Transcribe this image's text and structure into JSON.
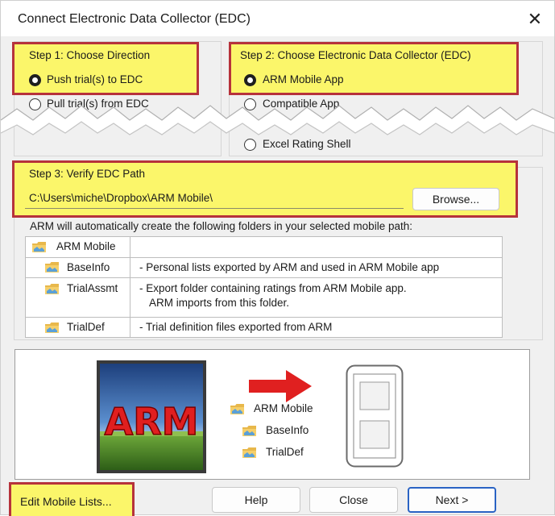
{
  "dialog": {
    "title": "Connect Electronic Data Collector (EDC)",
    "close_label": "✕"
  },
  "step1": {
    "heading": "Step 1: Choose Direction",
    "options": [
      "Push trial(s) to EDC",
      "Pull trial(s) from EDC"
    ],
    "selected": "Push trial(s) to EDC"
  },
  "step2": {
    "heading": "Step 2: Choose Electronic Data Collector (EDC)",
    "options": [
      "ARM Mobile App",
      "Compatible App",
      "Excel Rating Shell"
    ],
    "selected": "ARM Mobile App"
  },
  "step3": {
    "heading": "Step 3: Verify EDC Path",
    "path_value": "C:\\Users\\miche\\Dropbox\\ARM Mobile\\",
    "browse_label": "Browse..."
  },
  "folders": {
    "intro": "ARM will automatically create the following folders in your selected mobile path:",
    "root": "ARM Mobile",
    "rows": [
      {
        "name": "BaseInfo",
        "desc": "- Personal lists exported by ARM and used in ARM Mobile app",
        "desc2": ""
      },
      {
        "name": "TrialAssmt",
        "desc": "- Export folder containing ratings from ARM Mobile app.",
        "desc2": "ARM imports from this folder."
      },
      {
        "name": "TrialDef",
        "desc": "- Trial definition files exported from ARM",
        "desc2": ""
      }
    ]
  },
  "preview": {
    "logo_text": "ARM",
    "tree_root": "ARM Mobile",
    "tree_children": [
      "BaseInfo",
      "TrialDef"
    ]
  },
  "footer": {
    "edit_lists_label": "Edit Mobile Lists...",
    "help_label": "Help",
    "close_label": "Close",
    "next_label": "Next >"
  },
  "colors": {
    "highlight": "#fbf66a",
    "highlight_border": "#b6323b",
    "arrow": "#e02020",
    "primary_border": "#2a63c4"
  }
}
